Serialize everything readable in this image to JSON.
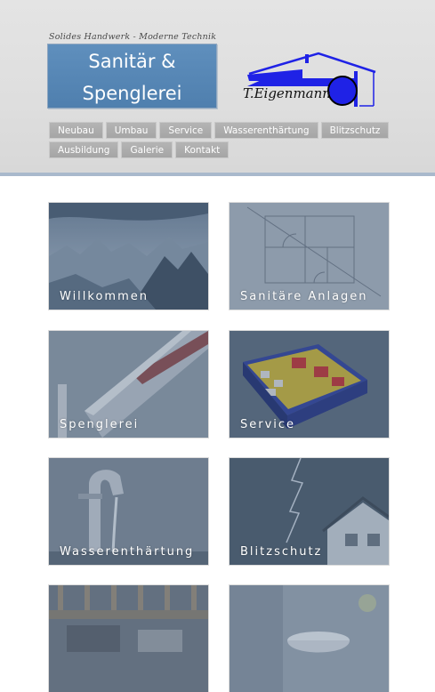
{
  "header": {
    "slogan": "Solides Handwerk - Moderne Technik",
    "title_line1": "Sanitär &",
    "title_line2": "Spenglerei",
    "logo_text": "T.Eigenmann"
  },
  "nav": {
    "row1": [
      "Neubau",
      "Umbau",
      "Service",
      "Wasserenthärtung",
      "Blitzschutz"
    ],
    "row2": [
      "Ausbildung",
      "Galerie",
      "Kontakt"
    ]
  },
  "tiles": [
    {
      "label": "Willkommen",
      "image": "mountains"
    },
    {
      "label": "Sanitäre Anlagen",
      "image": "floor-plan"
    },
    {
      "label": "Spenglerei",
      "image": "roof-gutter"
    },
    {
      "label": "Service",
      "image": "parts-box"
    },
    {
      "label": "Wasserenthärtung",
      "image": "faucet"
    },
    {
      "label": "Blitzschutz",
      "image": "lightning-house"
    },
    {
      "label": "",
      "image": "workbench-tools"
    },
    {
      "label": "",
      "image": "bathroom"
    }
  ],
  "colors": {
    "title_box": "#5886b5",
    "nav_button": "#adadad",
    "logo_blue": "#1f22e6",
    "header_border": "#a9b9cc",
    "tile_overlay": "#465f7d"
  }
}
